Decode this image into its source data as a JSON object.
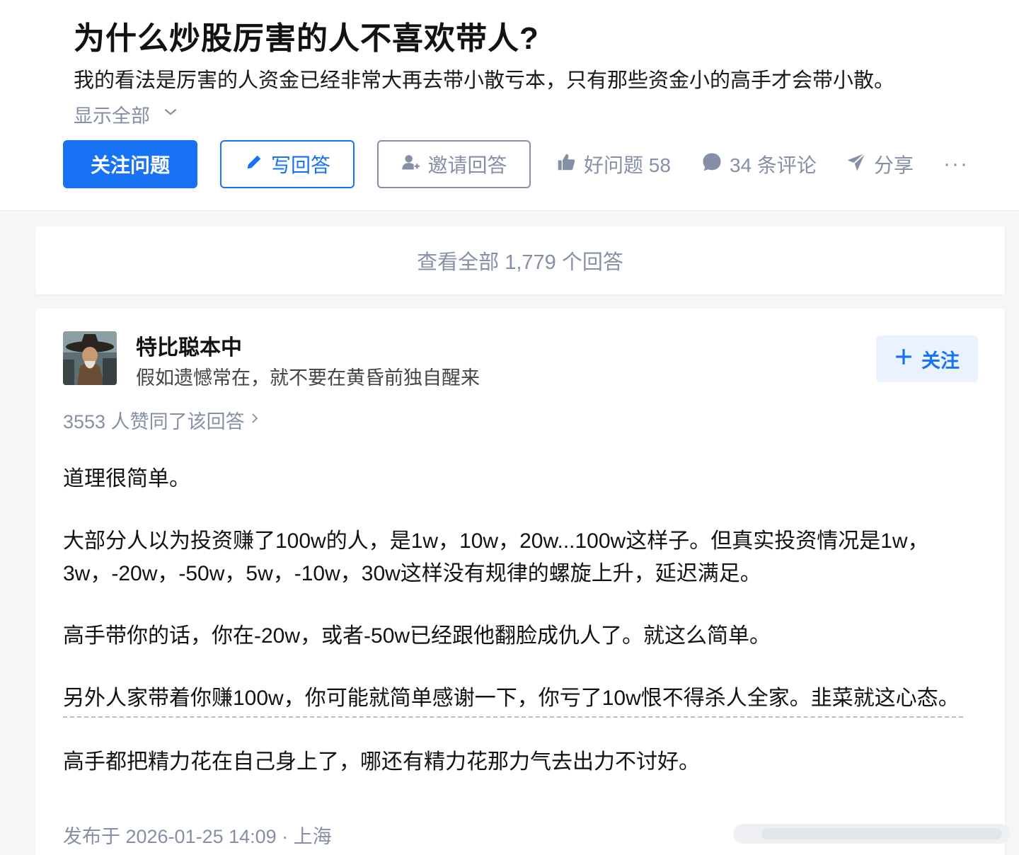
{
  "question": {
    "title": "为什么炒股厉害的人不喜欢带人?",
    "detail": "我的看法是厉害的人资金已经非常大再去带小散亏本，只有那些资金小的高手才会带小散。",
    "show_all_label": "显示全部"
  },
  "actions": {
    "follow_question": "关注问题",
    "write_answer": "写回答",
    "invite_answer": "邀请回答",
    "good_question": "好问题 58",
    "comments": "34 条评论",
    "share": "分享",
    "more": "···"
  },
  "view_all": "查看全部 1,779 个回答",
  "answer": {
    "author": {
      "name": "特比聪本中",
      "bio": "假如遗憾常在，就不要在黄昏前独自醒来",
      "follow_label": "关注"
    },
    "vote_summary": "3553 人赞同了该回答",
    "paragraphs": [
      "道理很简单。",
      "大部分人以为投资赚了100w的人，是1w，10w，20w...100w这样子。但真实投资情况是1w，",
      "3w，-20w，-50w，5w，-10w，30w这样没有规律的螺旋上升，延迟满足。",
      "高手带你的话，你在-20w，或者-50w已经跟他翻脸成仇人了。就这么简单。",
      "另外人家带着你赚100w，你可能就简单感谢一下，你亏了10w恨不得杀人全家。韭菜就这心态。",
      "高手都把精力花在自己身上了，哪还有精力花那力气去出力不讨好。"
    ],
    "publish_info": "发布于 2026-01-25 14:09 · 上海"
  },
  "colors": {
    "brand": "#1772f6",
    "muted": "#8590a6",
    "follow_bg": "#eaf2fd"
  },
  "icons": [
    "chevron-down-icon",
    "pencil-icon",
    "invite-user-icon",
    "thumbs-up-icon",
    "comment-bubble-icon",
    "share-plane-icon",
    "plus-icon",
    "chevron-right-icon"
  ]
}
